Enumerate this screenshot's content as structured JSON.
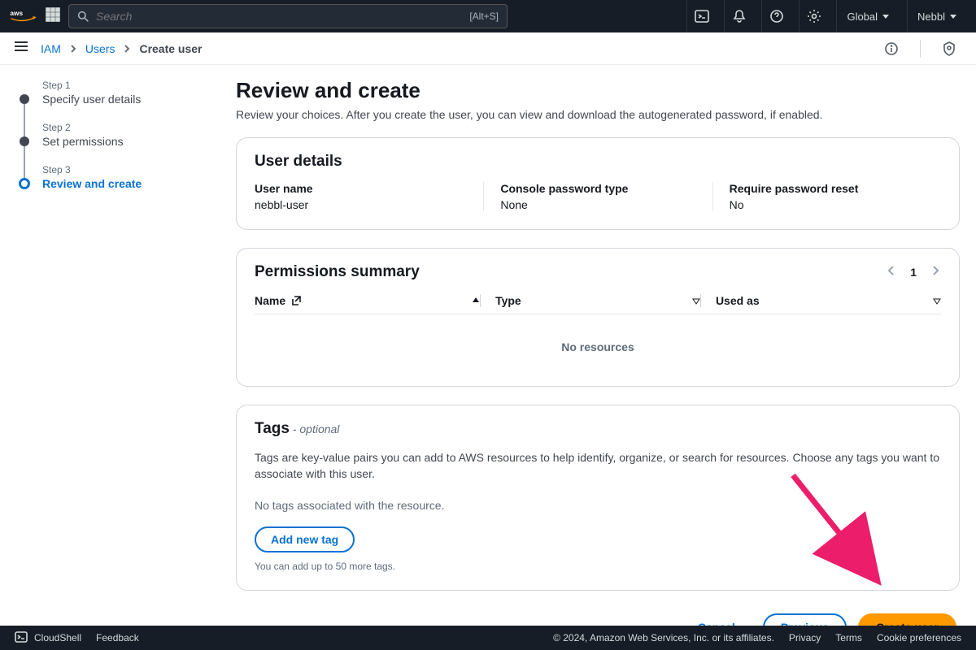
{
  "topnav": {
    "search_placeholder": "Search",
    "search_shortcut": "[Alt+S]",
    "region": "Global",
    "account": "Nebbl"
  },
  "breadcrumbs": {
    "items": [
      "IAM",
      "Users",
      "Create user"
    ]
  },
  "steps": [
    {
      "label_sm": "Step 1",
      "label": "Specify user details"
    },
    {
      "label_sm": "Step 2",
      "label": "Set permissions"
    },
    {
      "label_sm": "Step 3",
      "label": "Review and create"
    }
  ],
  "page": {
    "title": "Review and create",
    "subtitle": "Review your choices. After you create the user, you can view and download the autogenerated password, if enabled."
  },
  "user_details": {
    "heading": "User details",
    "fields": [
      {
        "label": "User name",
        "value": "nebbl-user"
      },
      {
        "label": "Console password type",
        "value": "None"
      },
      {
        "label": "Require password reset",
        "value": "No"
      }
    ]
  },
  "permissions": {
    "heading": "Permissions summary",
    "page_num": "1",
    "columns": [
      "Name",
      "Type",
      "Used as"
    ],
    "empty": "No resources"
  },
  "tags": {
    "heading": "Tags",
    "optional": " - optional",
    "desc": "Tags are key-value pairs you can add to AWS resources to help identify, organize, or search for resources. Choose any tags you want to associate with this user.",
    "empty": "No tags associated with the resource.",
    "add_button": "Add new tag",
    "hint": "You can add up to 50 more tags."
  },
  "wizard": {
    "cancel": "Cancel",
    "previous": "Previous",
    "create": "Create user"
  },
  "footer": {
    "cloudshell": "CloudShell",
    "feedback": "Feedback",
    "copyright": "© 2024, Amazon Web Services, Inc. or its affiliates.",
    "privacy": "Privacy",
    "terms": "Terms",
    "cookies": "Cookie preferences"
  }
}
